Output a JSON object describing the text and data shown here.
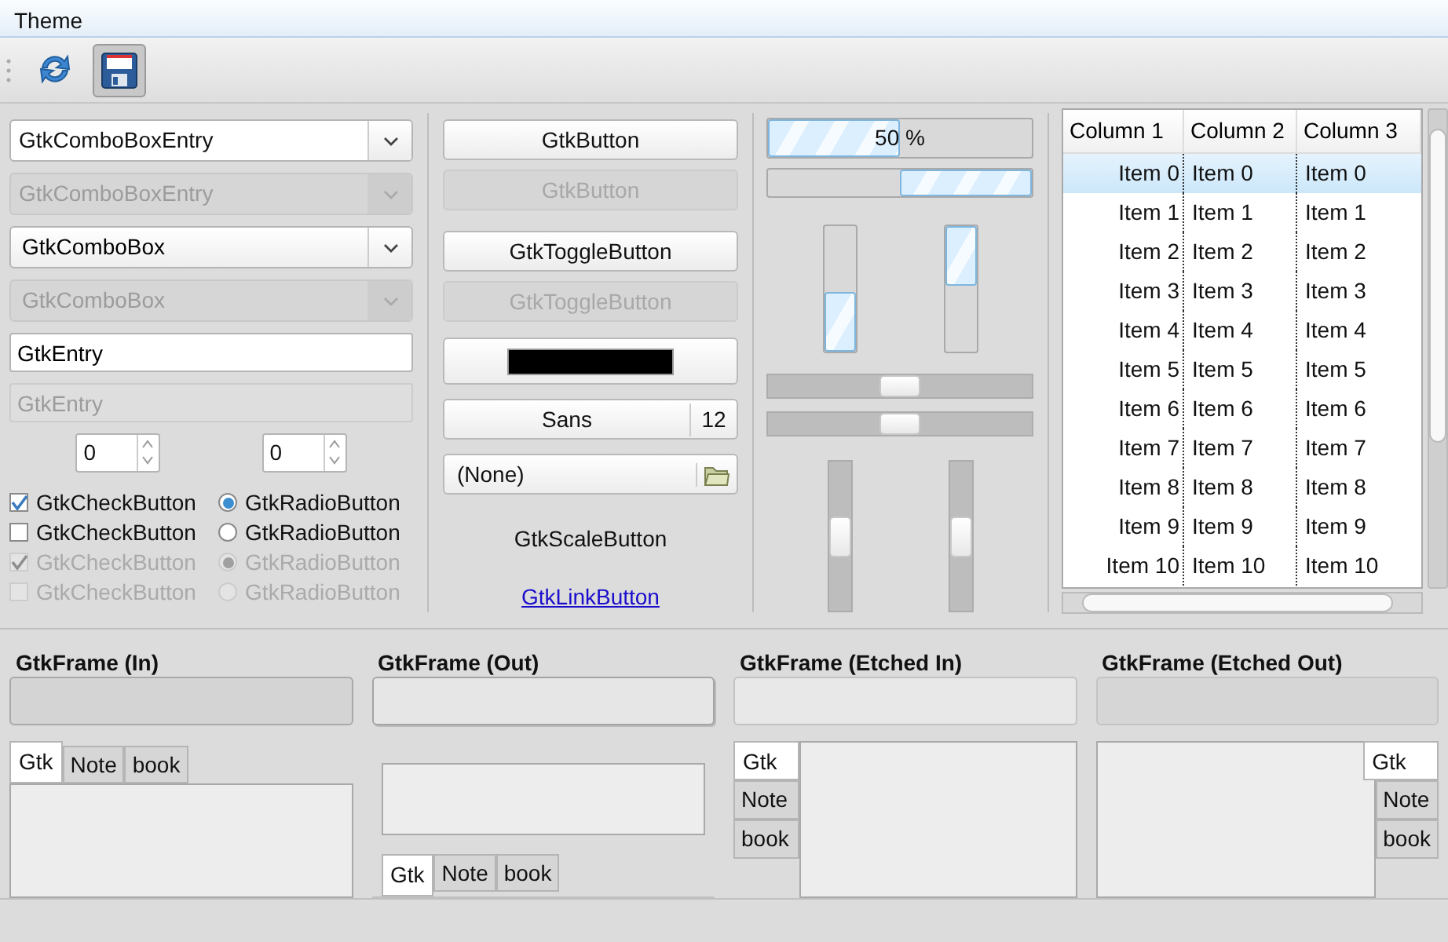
{
  "menu": [
    {
      "label": "Theme"
    }
  ],
  "toolbar": [
    {
      "kind": "refresh",
      "selected": false
    },
    {
      "kind": "save",
      "selected": true
    }
  ],
  "combos": [
    {
      "kind": "entry",
      "value": "GtkComboBoxEntry",
      "disabled": false
    },
    {
      "kind": "entry",
      "value": "GtkComboBoxEntry",
      "disabled": true
    },
    {
      "kind": "combo",
      "value": "GtkComboBox",
      "disabled": false
    },
    {
      "kind": "combo",
      "value": "GtkComboBox",
      "disabled": true
    }
  ],
  "entries": [
    {
      "value": "GtkEntry",
      "disabled": false
    },
    {
      "value": "GtkEntry",
      "disabled": true
    }
  ],
  "spin_buttons": [
    {
      "value": "0"
    },
    {
      "value": "0"
    }
  ],
  "check_buttons": [
    {
      "label": "GtkCheckButton",
      "checked": true,
      "disabled": false
    },
    {
      "label": "GtkCheckButton",
      "checked": false,
      "disabled": false
    },
    {
      "label": "GtkCheckButton",
      "checked": true,
      "disabled": true
    },
    {
      "label": "GtkCheckButton",
      "checked": false,
      "disabled": true
    }
  ],
  "radio_buttons": [
    {
      "label": "GtkRadioButton",
      "checked": true,
      "disabled": false
    },
    {
      "label": "GtkRadioButton",
      "checked": false,
      "disabled": false
    },
    {
      "label": "GtkRadioButton",
      "checked": true,
      "disabled": true
    },
    {
      "label": "GtkRadioButton",
      "checked": false,
      "disabled": true
    }
  ],
  "buttons": [
    {
      "label": "GtkButton",
      "disabled": false
    },
    {
      "label": "GtkButton",
      "disabled": true
    }
  ],
  "toggle_buttons": [
    {
      "label": "GtkToggleButton",
      "disabled": false
    },
    {
      "label": "GtkToggleButton",
      "disabled": true
    }
  ],
  "color_button": {
    "color": "#000000"
  },
  "font_button": {
    "font": "Sans",
    "size": "12"
  },
  "file_chooser": {
    "value": "(None)"
  },
  "scale_button": {
    "label": "GtkScaleButton"
  },
  "link_button": {
    "label": "GtkLinkButton"
  },
  "progress_bars": [
    {
      "kind": "horizontal",
      "inverted": false,
      "level": 0.5,
      "text": "50 %"
    },
    {
      "kind": "horizontal",
      "inverted": true,
      "level": 0.5
    },
    {
      "kind": "vertical",
      "inverted": false,
      "level": 0.48
    },
    {
      "kind": "vertical",
      "inverted": true,
      "level": 0.48
    }
  ],
  "scales": [
    {
      "kind": "horizontal",
      "level": 0.5
    },
    {
      "kind": "horizontal",
      "level": 0.5
    },
    {
      "kind": "vertical",
      "level": 0.5
    },
    {
      "kind": "vertical",
      "level": 0.5
    }
  ],
  "tree": {
    "columns": [
      "Column 1",
      "Column 2",
      "Column 3"
    ],
    "rows": [
      {
        "cells": [
          "Item 0",
          "Item 0",
          "Item 0"
        ],
        "selected": true
      },
      {
        "cells": [
          "Item 1",
          "Item 1",
          "Item 1"
        ],
        "selected": false
      },
      {
        "cells": [
          "Item 2",
          "Item 2",
          "Item 2"
        ],
        "selected": false
      },
      {
        "cells": [
          "Item 3",
          "Item 3",
          "Item 3"
        ],
        "selected": false
      },
      {
        "cells": [
          "Item 4",
          "Item 4",
          "Item 4"
        ],
        "selected": false
      },
      {
        "cells": [
          "Item 5",
          "Item 5",
          "Item 5"
        ],
        "selected": false
      },
      {
        "cells": [
          "Item 6",
          "Item 6",
          "Item 6"
        ],
        "selected": false
      },
      {
        "cells": [
          "Item 7",
          "Item 7",
          "Item 7"
        ],
        "selected": false
      },
      {
        "cells": [
          "Item 8",
          "Item 8",
          "Item 8"
        ],
        "selected": false
      },
      {
        "cells": [
          "Item 9",
          "Item 9",
          "Item 9"
        ],
        "selected": false
      },
      {
        "cells": [
          "Item 10",
          "Item 10",
          "Item 10"
        ],
        "selected": false
      }
    ]
  },
  "frames": [
    {
      "label": "GtkFrame (In)",
      "kind": "in"
    },
    {
      "label": "GtkFrame (Out)",
      "kind": "out"
    },
    {
      "label": "GtkFrame (Etched In)",
      "kind": "etched_in"
    },
    {
      "label": "GtkFrame (Etched Out)",
      "kind": "etched_out"
    }
  ],
  "notebooks": [
    {
      "kind": "top",
      "tabs": [
        {
          "label": "Gtk",
          "selected": true
        },
        {
          "label": "Note",
          "selected": false
        },
        {
          "label": "book",
          "selected": false
        }
      ]
    },
    {
      "kind": "bottom",
      "tabs": [
        {
          "label": "Gtk",
          "selected": true
        },
        {
          "label": "Note",
          "selected": false
        },
        {
          "label": "book",
          "selected": false
        }
      ]
    },
    {
      "kind": "left",
      "tabs": [
        {
          "label": "Gtk",
          "selected": true
        },
        {
          "label": "Note",
          "selected": false
        },
        {
          "label": "book",
          "selected": false
        }
      ]
    },
    {
      "kind": "right",
      "tabs": [
        {
          "label": "Gtk",
          "selected": true
        },
        {
          "label": "Note",
          "selected": false
        },
        {
          "label": "book",
          "selected": false
        }
      ]
    }
  ]
}
